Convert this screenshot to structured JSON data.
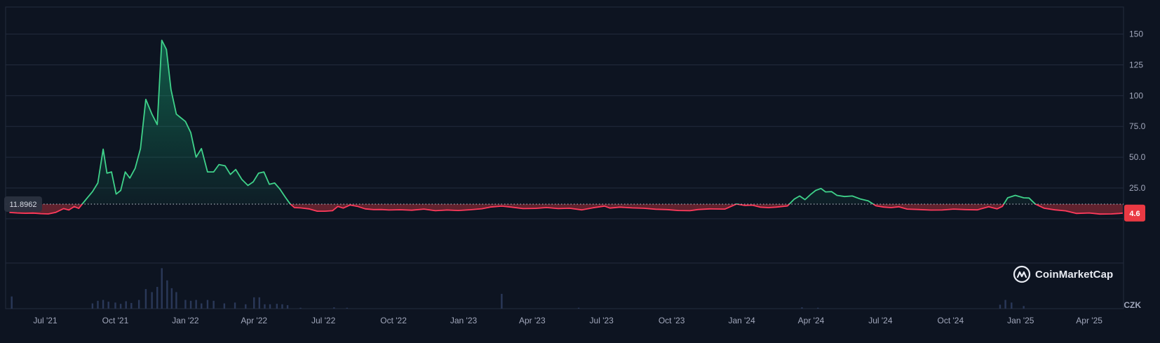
{
  "chart_data": {
    "type": "line",
    "title": "",
    "xlabel": "",
    "ylabel": "",
    "currency": "CZK",
    "ylim": [
      -36,
      172
    ],
    "y_ticks": [
      25,
      50,
      75,
      100,
      125,
      150
    ],
    "y_tick_labels": [
      "25.0",
      "50.0",
      "75.0",
      "100",
      "125",
      "150"
    ],
    "x_ticks": [
      {
        "date": "2021-07-01",
        "label": "Jul '21"
      },
      {
        "date": "2021-10-01",
        "label": "Oct '21"
      },
      {
        "date": "2022-01-01",
        "label": "Jan '22"
      },
      {
        "date": "2022-04-01",
        "label": "Apr '22"
      },
      {
        "date": "2022-07-01",
        "label": "Jul '22"
      },
      {
        "date": "2022-10-01",
        "label": "Oct '22"
      },
      {
        "date": "2023-01-01",
        "label": "Jan '23"
      },
      {
        "date": "2023-04-01",
        "label": "Apr '23"
      },
      {
        "date": "2023-07-01",
        "label": "Jul '23"
      },
      {
        "date": "2023-10-01",
        "label": "Oct '23"
      },
      {
        "date": "2024-01-01",
        "label": "Jan '24"
      },
      {
        "date": "2024-04-01",
        "label": "Apr '24"
      },
      {
        "date": "2024-07-01",
        "label": "Jul '24"
      },
      {
        "date": "2024-10-01",
        "label": "Oct '24"
      },
      {
        "date": "2025-01-01",
        "label": "Jan '25"
      },
      {
        "date": "2025-04-01",
        "label": "Apr '25"
      }
    ],
    "baseline": {
      "value": 11.8962,
      "label": "11.8962"
    },
    "current": {
      "value": 4.6,
      "label": "4.6"
    },
    "colors": {
      "above": "#16c784",
      "below": "#ea3943",
      "line_above": "#3fd28a",
      "line_below": "#ff3a5c",
      "volume": "#2a3858"
    },
    "series": [
      {
        "values": [
          [
            "2021-05-15",
            5.1
          ],
          [
            "2021-05-25",
            4.7
          ],
          [
            "2021-06-05",
            4.4
          ],
          [
            "2021-06-15",
            4.6
          ],
          [
            "2021-06-25",
            4.1
          ],
          [
            "2021-07-05",
            3.9
          ],
          [
            "2021-07-15",
            5.2
          ],
          [
            "2021-07-25",
            8.2
          ],
          [
            "2021-08-01",
            7.1
          ],
          [
            "2021-08-08",
            9.9
          ],
          [
            "2021-08-14",
            8.4
          ],
          [
            "2021-08-20",
            13
          ],
          [
            "2021-08-26",
            17.5
          ],
          [
            "2021-09-01",
            22
          ],
          [
            "2021-09-08",
            29
          ],
          [
            "2021-09-15",
            56.5
          ],
          [
            "2021-09-20",
            37
          ],
          [
            "2021-09-26",
            38
          ],
          [
            "2021-10-02",
            20
          ],
          [
            "2021-10-08",
            23
          ],
          [
            "2021-10-14",
            38
          ],
          [
            "2021-10-20",
            33
          ],
          [
            "2021-10-27",
            41
          ],
          [
            "2021-11-03",
            57
          ],
          [
            "2021-11-10",
            97
          ],
          [
            "2021-11-18",
            85
          ],
          [
            "2021-11-25",
            76.5
          ],
          [
            "2021-12-01",
            145
          ],
          [
            "2021-12-07",
            137.5
          ],
          [
            "2021-12-13",
            105
          ],
          [
            "2021-12-20",
            85
          ],
          [
            "2022-01-01",
            79
          ],
          [
            "2022-01-08",
            70
          ],
          [
            "2022-01-15",
            50
          ],
          [
            "2022-01-22",
            57
          ],
          [
            "2022-01-30",
            38
          ],
          [
            "2022-02-07",
            38
          ],
          [
            "2022-02-14",
            44
          ],
          [
            "2022-02-22",
            43
          ],
          [
            "2022-03-01",
            36
          ],
          [
            "2022-03-08",
            40
          ],
          [
            "2022-03-16",
            32
          ],
          [
            "2022-03-24",
            27
          ],
          [
            "2022-03-31",
            30
          ],
          [
            "2022-04-07",
            37
          ],
          [
            "2022-04-14",
            38
          ],
          [
            "2022-04-21",
            28
          ],
          [
            "2022-04-28",
            29
          ],
          [
            "2022-05-05",
            24
          ],
          [
            "2022-05-12",
            17.5
          ],
          [
            "2022-05-18",
            12.3
          ],
          [
            "2022-05-24",
            9
          ],
          [
            "2022-06-01",
            8.8
          ],
          [
            "2022-06-12",
            8
          ],
          [
            "2022-06-23",
            6.1
          ],
          [
            "2022-07-03",
            6.1
          ],
          [
            "2022-07-13",
            6.5
          ],
          [
            "2022-07-20",
            10
          ],
          [
            "2022-07-27",
            8.6
          ],
          [
            "2022-08-05",
            11.1
          ],
          [
            "2022-08-15",
            10
          ],
          [
            "2022-08-25",
            8
          ],
          [
            "2022-09-05",
            7.4
          ],
          [
            "2022-09-15",
            7.5
          ],
          [
            "2022-09-25",
            7.1
          ],
          [
            "2022-10-10",
            7.3
          ],
          [
            "2022-10-25",
            6.9
          ],
          [
            "2022-11-10",
            7.8
          ],
          [
            "2022-11-25",
            6.5
          ],
          [
            "2022-12-10",
            7.1
          ],
          [
            "2022-12-25",
            6.7
          ],
          [
            "2023-01-10",
            7.3
          ],
          [
            "2023-01-25",
            8.1
          ],
          [
            "2023-02-05",
            9.5
          ],
          [
            "2023-02-20",
            10.2
          ],
          [
            "2023-03-05",
            9.4
          ],
          [
            "2023-03-20",
            8.2
          ],
          [
            "2023-04-05",
            8.4
          ],
          [
            "2023-04-20",
            9.1
          ],
          [
            "2023-05-05",
            8.2
          ],
          [
            "2023-05-20",
            8.5
          ],
          [
            "2023-06-05",
            7.2
          ],
          [
            "2023-06-20",
            8.9
          ],
          [
            "2023-07-05",
            10.3
          ],
          [
            "2023-07-12",
            8.6
          ],
          [
            "2023-07-25",
            9.4
          ],
          [
            "2023-08-10",
            8.8
          ],
          [
            "2023-08-25",
            8.5
          ],
          [
            "2023-09-10",
            7.7
          ],
          [
            "2023-09-25",
            7.4
          ],
          [
            "2023-10-10",
            6.7
          ],
          [
            "2023-10-25",
            6.5
          ],
          [
            "2023-11-05",
            7.5
          ],
          [
            "2023-11-20",
            8
          ],
          [
            "2023-12-10",
            7.8
          ],
          [
            "2023-12-25",
            11.9
          ],
          [
            "2024-01-05",
            10.8
          ],
          [
            "2024-01-15",
            11
          ],
          [
            "2024-01-25",
            9.4
          ],
          [
            "2024-02-05",
            9
          ],
          [
            "2024-02-15",
            9.4
          ],
          [
            "2024-03-01",
            10.4
          ],
          [
            "2024-03-10",
            16
          ],
          [
            "2024-03-17",
            18.5
          ],
          [
            "2024-03-24",
            15.5
          ],
          [
            "2024-03-31",
            19.5
          ],
          [
            "2024-04-07",
            23
          ],
          [
            "2024-04-14",
            24.6
          ],
          [
            "2024-04-20",
            21.8
          ],
          [
            "2024-04-28",
            22
          ],
          [
            "2024-05-05",
            19
          ],
          [
            "2024-05-15",
            18
          ],
          [
            "2024-05-25",
            18.5
          ],
          [
            "2024-06-05",
            16
          ],
          [
            "2024-06-15",
            14.5
          ],
          [
            "2024-06-25",
            10.5
          ],
          [
            "2024-07-05",
            9.5
          ],
          [
            "2024-07-15",
            9
          ],
          [
            "2024-07-25",
            9.7
          ],
          [
            "2024-08-05",
            7.8
          ],
          [
            "2024-08-20",
            7.5
          ],
          [
            "2024-09-05",
            7
          ],
          [
            "2024-09-20",
            7.1
          ],
          [
            "2024-10-05",
            7.8
          ],
          [
            "2024-10-20",
            7.4
          ],
          [
            "2024-11-05",
            7.2
          ],
          [
            "2024-11-20",
            9.7
          ],
          [
            "2024-12-01",
            8
          ],
          [
            "2024-12-08",
            10
          ],
          [
            "2024-12-15",
            17
          ],
          [
            "2024-12-25",
            19
          ],
          [
            "2025-01-05",
            17
          ],
          [
            "2025-01-12",
            16.8
          ],
          [
            "2025-01-20",
            12
          ],
          [
            "2025-02-01",
            8.5
          ],
          [
            "2025-02-15",
            7.2
          ],
          [
            "2025-03-01",
            6.4
          ],
          [
            "2025-03-15",
            4.3
          ],
          [
            "2025-04-01",
            4.7
          ],
          [
            "2025-04-15",
            3.8
          ],
          [
            "2025-04-30",
            3.9
          ],
          [
            "2025-05-10",
            4.3
          ],
          [
            "2025-05-15",
            4.6
          ]
        ]
      }
    ],
    "volume": [
      [
        "2021-05-18",
        0.28
      ],
      [
        "2021-09-01",
        0.12
      ],
      [
        "2021-09-08",
        0.18
      ],
      [
        "2021-09-15",
        0.2
      ],
      [
        "2021-09-22",
        0.16
      ],
      [
        "2021-10-01",
        0.14
      ],
      [
        "2021-10-08",
        0.11
      ],
      [
        "2021-10-15",
        0.17
      ],
      [
        "2021-10-22",
        0.13
      ],
      [
        "2021-11-01",
        0.2
      ],
      [
        "2021-11-10",
        0.45
      ],
      [
        "2021-11-18",
        0.38
      ],
      [
        "2021-11-25",
        0.5
      ],
      [
        "2021-12-01",
        0.93
      ],
      [
        "2021-12-08",
        0.65
      ],
      [
        "2021-12-14",
        0.47
      ],
      [
        "2021-12-20",
        0.38
      ],
      [
        "2022-01-01",
        0.2
      ],
      [
        "2022-01-08",
        0.18
      ],
      [
        "2022-01-15",
        0.2
      ],
      [
        "2022-01-22",
        0.12
      ],
      [
        "2022-01-30",
        0.2
      ],
      [
        "2022-02-07",
        0.18
      ],
      [
        "2022-02-21",
        0.12
      ],
      [
        "2022-03-07",
        0.14
      ],
      [
        "2022-03-21",
        0.1
      ],
      [
        "2022-04-01",
        0.26
      ],
      [
        "2022-04-08",
        0.26
      ],
      [
        "2022-04-15",
        0.1
      ],
      [
        "2022-04-22",
        0.1
      ],
      [
        "2022-05-01",
        0.11
      ],
      [
        "2022-05-08",
        0.1
      ],
      [
        "2022-05-15",
        0.08
      ],
      [
        "2022-06-01",
        0.02
      ],
      [
        "2022-07-15",
        0.03
      ],
      [
        "2022-08-01",
        0.02
      ],
      [
        "2023-02-20",
        0.34
      ],
      [
        "2023-06-01",
        0.02
      ],
      [
        "2024-03-20",
        0.03
      ],
      [
        "2024-04-10",
        0.02
      ],
      [
        "2024-12-05",
        0.09
      ],
      [
        "2024-12-12",
        0.2
      ],
      [
        "2024-12-20",
        0.14
      ],
      [
        "2025-01-05",
        0.06
      ]
    ]
  },
  "currency_label": "CZK",
  "brand": {
    "name": "CoinMarketCap"
  }
}
